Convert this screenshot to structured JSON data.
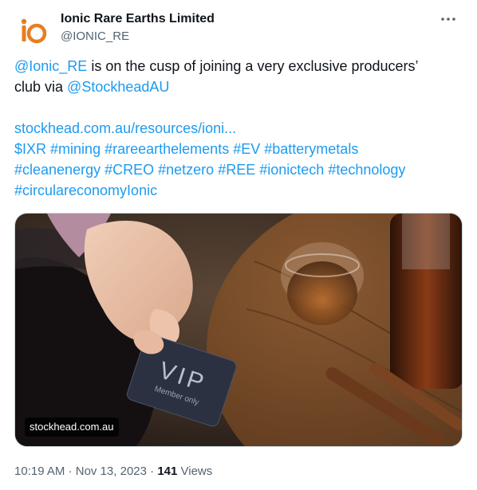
{
  "author": {
    "display_name": "Ionic Rare Earths Limited",
    "handle": "@IONIC_RE"
  },
  "tweet": {
    "line1": {
      "mention": "@Ionic_RE",
      "text": " is on the cusp of joining a very exclusive producers’"
    },
    "line2": {
      "text": "club via ",
      "mention": "@StockheadAU"
    },
    "url": "stockhead.com.au/resources/ioni...",
    "hashtag_lines": [
      [
        "$IXR",
        "#mining",
        "#rareearthelements",
        "#EV",
        "#batterymetals"
      ],
      [
        "#cleanenergy",
        "#CREO",
        "#netzero",
        "#REE",
        "#ionictech",
        "#technology"
      ],
      [
        "#circulareconomyIonic"
      ]
    ]
  },
  "media": {
    "card_domain": "stockhead.com.au",
    "card_text_line1": "VIP",
    "card_text_line2": "Member only"
  },
  "meta": {
    "time": "10:19 AM",
    "separator": " · ",
    "date": "Nov 13, 2023",
    "views_count": "141",
    "views_label": " Views"
  },
  "icons": {
    "more": "more-dots-icon",
    "avatar_logo": "io-logo"
  },
  "colors": {
    "link": "#1d9bf0",
    "secondary_text": "#536471",
    "logo_orange": "#e67e22"
  }
}
